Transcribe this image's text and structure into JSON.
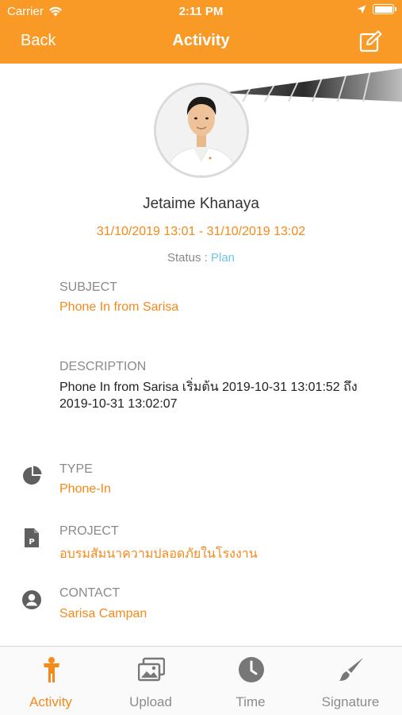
{
  "status_bar": {
    "carrier": "Carrier",
    "time": "2:11 PM"
  },
  "nav": {
    "back_label": "Back",
    "title": "Activity"
  },
  "profile": {
    "name": "Jetaime Khanaya",
    "date_range": "31/10/2019 13:01 - 31/10/2019 13:02",
    "status_label": "Status :",
    "status_value": "Plan"
  },
  "fields": {
    "subject": {
      "label": "SUBJECT",
      "value": "Phone In from  Sarisa"
    },
    "description": {
      "label": "DESCRIPTION",
      "value": "Phone In from  Sarisa  เริ่มต้น  2019-10-31 13:01:52 ถึง 2019-10-31 13:02:07"
    },
    "type": {
      "label": "TYPE",
      "value": "Phone-In"
    },
    "project": {
      "label": "PROJECT",
      "value": "อบรมสัมนาความปลอดภัยในโรงงาน"
    },
    "contact": {
      "label": "CONTACT",
      "value": "Sarisa Campan"
    }
  },
  "tabs": [
    {
      "label": "Activity",
      "icon": "person-icon",
      "active": true
    },
    {
      "label": "Upload",
      "icon": "images-icon",
      "active": false
    },
    {
      "label": "Time",
      "icon": "clock-icon",
      "active": false
    },
    {
      "label": "Signature",
      "icon": "brush-icon",
      "active": false
    }
  ],
  "colors": {
    "accent": "#f99a26",
    "orange_text": "#f5891a",
    "status_blue": "#6cc6ee",
    "gray_text": "#8a8a8a"
  }
}
